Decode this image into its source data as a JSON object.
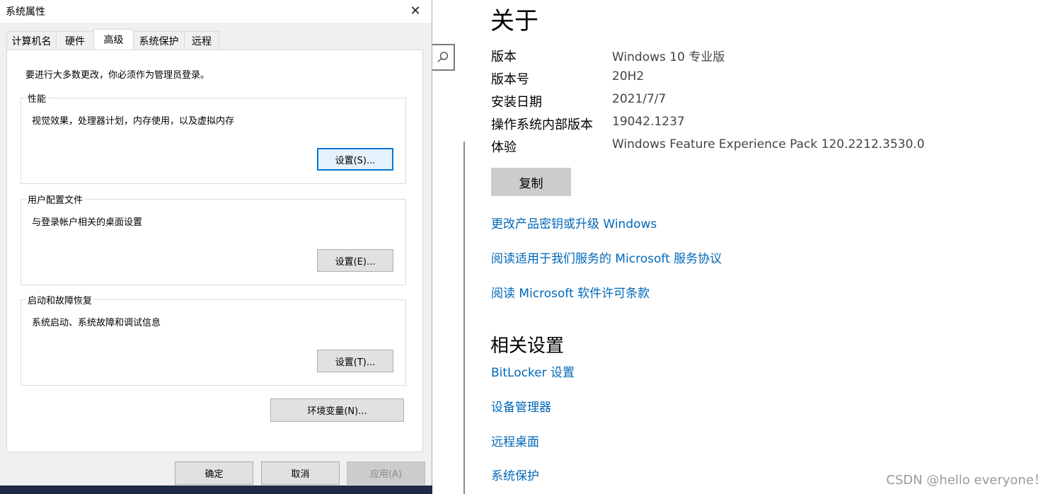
{
  "dialog": {
    "title": "系统属性",
    "close_glyph": "✕",
    "tabs": [
      {
        "label": "计算机名"
      },
      {
        "label": "硬件"
      },
      {
        "label": "高级"
      },
      {
        "label": "系统保护"
      },
      {
        "label": "远程"
      }
    ],
    "active_tab": "高级",
    "admin_note": "要进行大多数更改，你必须作为管理员登录。",
    "groups": [
      {
        "title": "性能",
        "description": "视觉效果，处理器计划，内存使用，以及虚拟内存",
        "button": "设置(S)..."
      },
      {
        "title": "用户配置文件",
        "description": "与登录帐户相关的桌面设置",
        "button": "设置(E)..."
      },
      {
        "title": "启动和故障恢复",
        "description": "系统启动、系统故障和调试信息",
        "button": "设置(T)..."
      }
    ],
    "env_button": "环境变量(N)...",
    "ok_button": "确定",
    "cancel_button": "取消",
    "apply_button": "应用(A)"
  },
  "settings": {
    "title": "关于",
    "specs": [
      {
        "label": "版本",
        "value": "Windows 10 专业版"
      },
      {
        "label": "版本号",
        "value": "20H2"
      },
      {
        "label": "安装日期",
        "value": "2021/7/7"
      },
      {
        "label": "操作系统内部版本",
        "value": "19042.1237"
      },
      {
        "label": "体验",
        "value": "Windows Feature Experience Pack 120.2212.3530.0"
      }
    ],
    "copy_button": "复制",
    "links": [
      {
        "label": "更改产品密钥或升级 Windows"
      },
      {
        "label": "阅读适用于我们服务的 Microsoft 服务协议"
      },
      {
        "label": "阅读 Microsoft 软件许可条款"
      }
    ],
    "related_title": "相关设置",
    "related_links": [
      {
        "label": "BitLocker 设置"
      },
      {
        "label": "设备管理器"
      },
      {
        "label": "远程桌面"
      },
      {
        "label": "系统保护"
      }
    ]
  },
  "watermark": "CSDN @hello everyone！",
  "colors": {
    "link": "#0067b8",
    "focus_border": "#0078d7",
    "dialog_bg": "#f0f0f0"
  }
}
